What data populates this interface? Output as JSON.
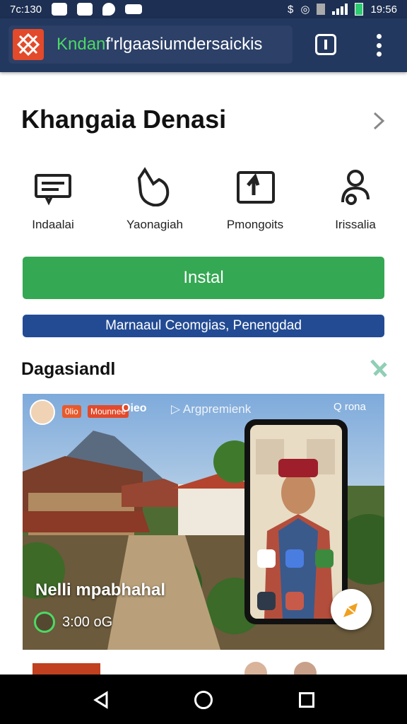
{
  "status_bar": {
    "time": "7c:130",
    "clock_right": "19:56"
  },
  "app_bar": {
    "url_highlight": "Kndan",
    "url_rest": "f'rlgaasiumdersaickis",
    "url_color": "#4cd964",
    "bg_color": "#23385e"
  },
  "page": {
    "title": "Khangaia Denasi"
  },
  "actions": [
    {
      "label": "Indaalai",
      "icon": "message-card-icon"
    },
    {
      "label": "Yaonagiah",
      "icon": "pointer-hand-icon"
    },
    {
      "label": "Pmongoits",
      "icon": "upload-box-icon"
    },
    {
      "label": "Irissalia",
      "icon": "person-icon"
    }
  ],
  "install_button": {
    "label": "Instal",
    "color": "#34a853"
  },
  "info_bar": {
    "text": "Marnaaul Ceomgias, Penengdad",
    "color": "#234b94"
  },
  "section": {
    "title": "Dagasiandl"
  },
  "media_card": {
    "badge_1": "0lio",
    "badge_2": "Mounnee",
    "tag": "Oieo",
    "link_text": "Argpremienk",
    "counter": "Q rona",
    "caption": "Nelli mpabhahal",
    "duration": "3:00 oG"
  }
}
